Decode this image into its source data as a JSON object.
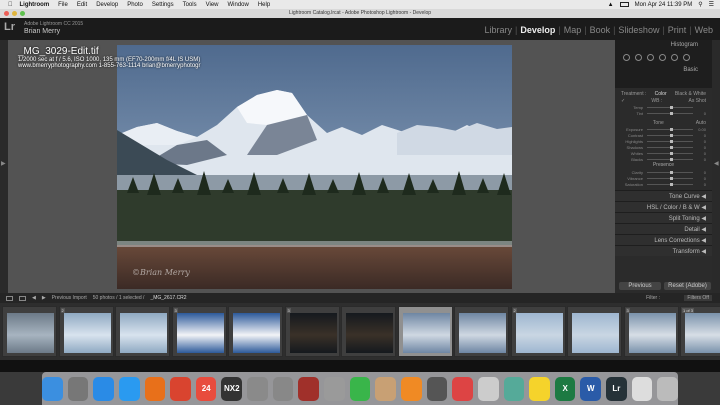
{
  "menubar": {
    "app": "Lightroom",
    "items": [
      "File",
      "Edit",
      "Develop",
      "Photo",
      "Settings",
      "Tools",
      "View",
      "Window",
      "Help"
    ],
    "clock": "Mon Apr 24  11:39 PM"
  },
  "window": {
    "title": "Lightroom Catalog.lrcat - Adobe Photoshop Lightroom - Develop"
  },
  "identity": {
    "logo": "Lr",
    "product": "Adobe Lightroom CC 2015",
    "user": "Brian Merry"
  },
  "modules": [
    "Library",
    "Develop",
    "Map",
    "Book",
    "Slideshow",
    "Print",
    "Web"
  ],
  "active_module": "Develop",
  "photo_info": {
    "filename": "_MG_3029-Edit.tif",
    "exif": "1/2000 sec at f / 5.6, ISO 1000, 135 mm (EF70-200mm f/4L IS USM)",
    "contact": "www.bmerryphotography.com 1-855-763-1114 brian@bmerryphotogr",
    "watermark": "©Brian Merry"
  },
  "right_panel": {
    "histogram": "Histogram",
    "basic": "Basic",
    "treatment_label": "Treatment :",
    "treatment_color": "Color",
    "treatment_bw": "Black & White",
    "wb_label": "WB :",
    "wb_value": "As Shot",
    "tone_label": "Tone",
    "tone_auto": "Auto",
    "presence_label": "Presence",
    "sliders_wb": [
      {
        "label": "Temp",
        "value": "",
        "pos": 0.5
      },
      {
        "label": "Tint",
        "value": "0",
        "pos": 0.5
      }
    ],
    "sliders_tone": [
      {
        "label": "Exposure",
        "value": "0.00",
        "pos": 0.5
      },
      {
        "label": "Contrast",
        "value": "0",
        "pos": 0.5
      },
      {
        "label": "Highlights",
        "value": "0",
        "pos": 0.5
      },
      {
        "label": "Shadows",
        "value": "0",
        "pos": 0.5
      },
      {
        "label": "Whites",
        "value": "0",
        "pos": 0.5
      },
      {
        "label": "Blacks",
        "value": "0",
        "pos": 0.5
      }
    ],
    "sliders_presence": [
      {
        "label": "Clarity",
        "value": "0",
        "pos": 0.5
      },
      {
        "label": "Vibrance",
        "value": "0",
        "pos": 0.5
      },
      {
        "label": "Saturation",
        "value": "0",
        "pos": 0.5
      }
    ],
    "collapsed_panels": [
      "Tone Curve",
      "HSL / Color / B & W",
      "Split Toning",
      "Detail",
      "Lens Corrections",
      "Transform"
    ],
    "previous_button": "Previous",
    "reset_button": "Reset (Adobe)"
  },
  "filmstrip_bar": {
    "source": "Previous Import",
    "count": "50 photos / 1 selected /",
    "selected_file": "_MG_2617.CR2",
    "filter_label": "Filter :",
    "filter_value": "Filters Off"
  },
  "thumbnails": [
    {
      "badge": "",
      "kind": "rock"
    },
    {
      "badge": "2",
      "kind": "ice"
    },
    {
      "badge": "",
      "kind": "ice"
    },
    {
      "badge": "3",
      "kind": "snow"
    },
    {
      "badge": "",
      "kind": "snow"
    },
    {
      "badge": "3",
      "kind": "dark"
    },
    {
      "badge": "",
      "kind": "dark"
    },
    {
      "badge": "",
      "kind": "mountain",
      "selected": true
    },
    {
      "badge": "",
      "kind": "mountain"
    },
    {
      "badge": "2",
      "kind": "bird"
    },
    {
      "badge": "",
      "kind": "bird"
    },
    {
      "badge": "3",
      "kind": "lake"
    },
    {
      "badge": "1 of 3",
      "kind": "lake"
    }
  ],
  "dock": [
    {
      "name": "Finder",
      "color": "#3b8fe0"
    },
    {
      "name": "Launchpad",
      "color": "#777"
    },
    {
      "name": "App Store",
      "color": "#2a8be6"
    },
    {
      "name": "Safari",
      "color": "#2a9af0"
    },
    {
      "name": "Firefox",
      "color": "#e8701a"
    },
    {
      "name": "Chrome",
      "color": "#d9442f"
    },
    {
      "name": "Calendar",
      "color": "#e84c3d",
      "label": "24"
    },
    {
      "name": "NX2",
      "color": "#333",
      "label": "NX2"
    },
    {
      "name": "Preview",
      "color": "#8a8a8a"
    },
    {
      "name": "System Preferences",
      "color": "#888"
    },
    {
      "name": "Photo Booth",
      "color": "#a0302a"
    },
    {
      "name": "Photos",
      "color": "#9a9a9a"
    },
    {
      "name": "FaceTime",
      "color": "#39b54a"
    },
    {
      "name": "Contacts",
      "color": "#c8a074"
    },
    {
      "name": "iBooks",
      "color": "#f08a24"
    },
    {
      "name": "Time Machine",
      "color": "#555"
    },
    {
      "name": "Help",
      "color": "#d44"
    },
    {
      "name": "Grab",
      "color": "#ccc"
    },
    {
      "name": "Image Capture",
      "color": "#5a9"
    },
    {
      "name": "Photos App",
      "color": "#f5d32b"
    },
    {
      "name": "Excel",
      "color": "#1d7a42",
      "label": "X"
    },
    {
      "name": "Word",
      "color": "#2a5ba8",
      "label": "W"
    },
    {
      "name": "Lightroom",
      "color": "#263238",
      "label": "Lr"
    },
    {
      "name": "Documents",
      "color": "#ddd"
    },
    {
      "name": "Trash",
      "color": "#bbb"
    }
  ]
}
